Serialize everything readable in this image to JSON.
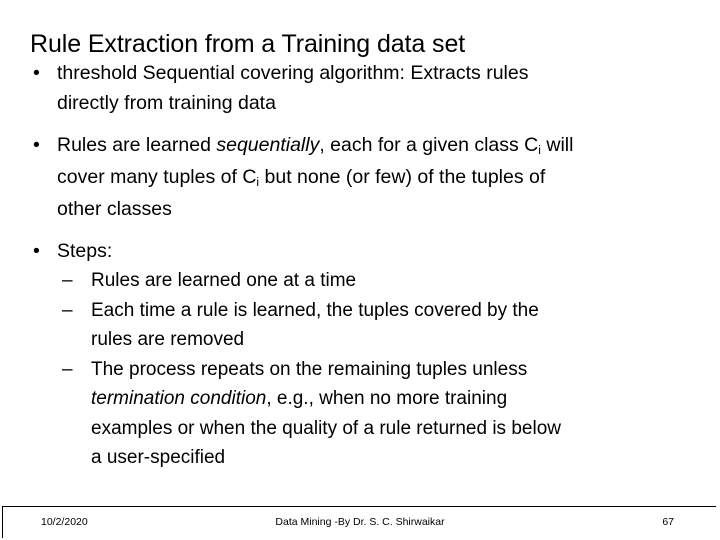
{
  "slide": {
    "title": "Rule Extraction from a Training data set",
    "background_color": "#ffffff",
    "text_color": "#000000"
  },
  "bullets": {
    "level1_marker": "•",
    "level2_marker": "–",
    "b1": {
      "line1": "threshold Sequential covering algorithm: Extracts rules",
      "line2": "directly from training data"
    },
    "b2": {
      "l1_pre": "Rules are learned ",
      "l1_italic": "sequentially",
      "l1_post_a": ", each for a given class C",
      "l1_sub": "i",
      "l1_post_b": " will",
      "l2_pre": "cover many tuples of C",
      "l2_sub": "i",
      "l2_post": " but none (or few) of the tuples of",
      "l3": "other classes"
    },
    "b3": {
      "label": "Steps:"
    },
    "sub1": {
      "line1": "Rules are learned one at a time"
    },
    "sub2": {
      "line1": "Each time a rule is learned, the tuples covered by the",
      "line2": "rules are removed"
    },
    "sub3": {
      "line1": "The process repeats on the remaining tuples unless",
      "line2_italic": "termination condition",
      "line2_post": ", e.g., when no more training",
      "line3": "examples or when the quality of a rule returned is below",
      "line4": "a user-specified"
    }
  },
  "footer": {
    "date": "10/2/2020",
    "center": "Data Mining -By Dr. S. C. Shirwaikar",
    "page_number": "67"
  }
}
